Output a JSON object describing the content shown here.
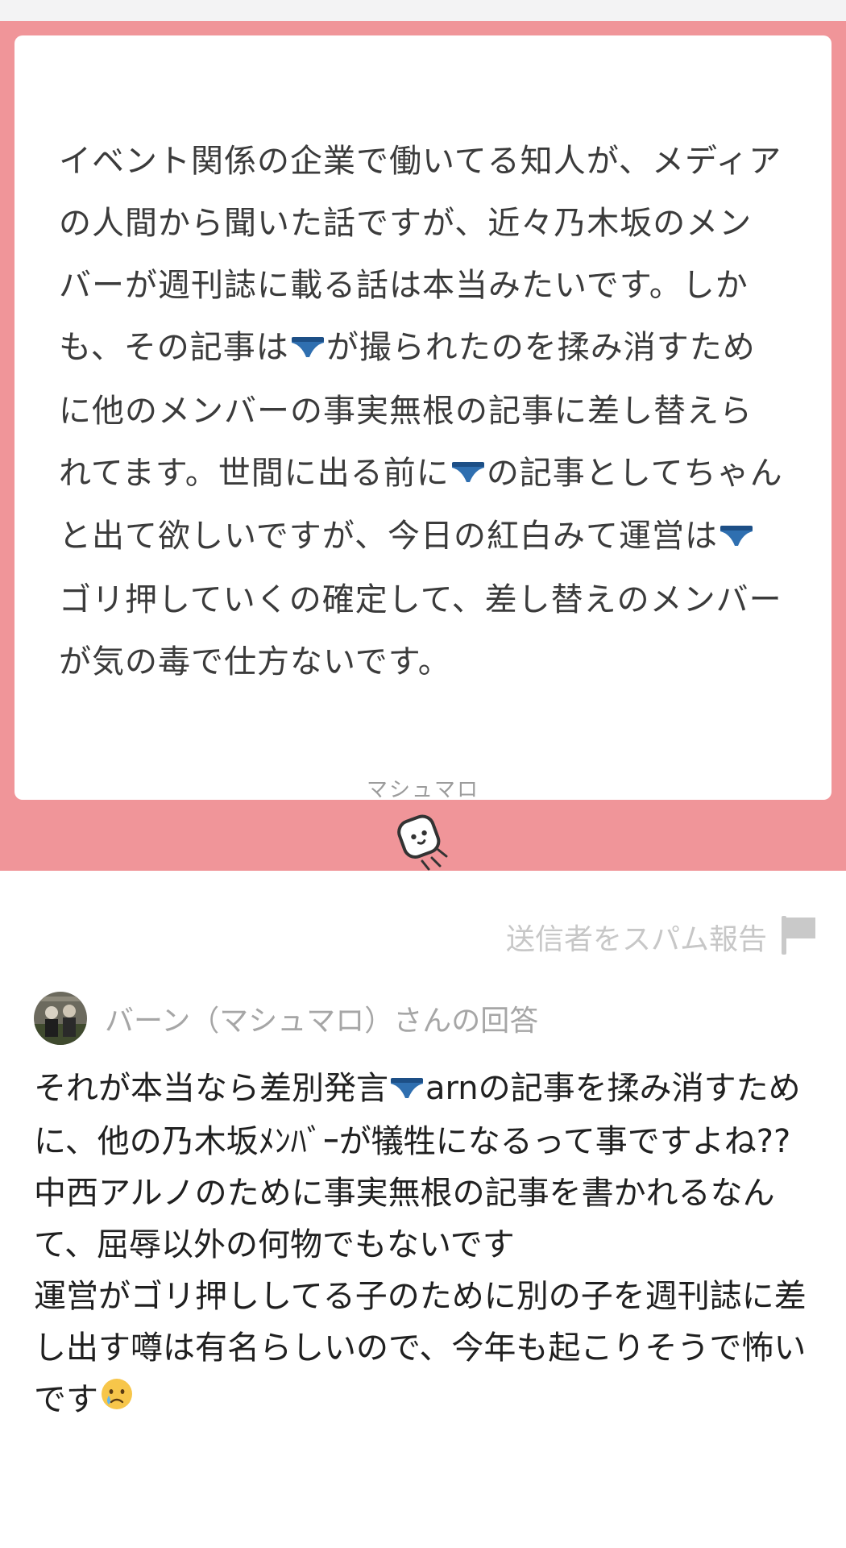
{
  "question": {
    "segments": [
      {
        "text": "イベント関係の企業で働いてる知人が、メディアの人間から聞いた話ですが、近々乃木坂のメンバーが週刊誌に載る話は本当みたいです。しかも、その記事は"
      },
      {
        "emoji": "blue-briefs-emoji"
      },
      {
        "text": "が撮られたのを揉み消すために他のメンバーの事実無根の記事に差し替えられてます。世間に出る前に"
      },
      {
        "emoji": "blue-briefs-emoji"
      },
      {
        "text": "の記事としてちゃんと出て欲しいですが、今日の紅白みて運営は"
      },
      {
        "emoji": "blue-briefs-emoji"
      },
      {
        "text": "ゴリ押していくの確定して、差し替えのメンバーが気の毒で仕方ないです。"
      }
    ]
  },
  "brand": {
    "label": "マシュマロ",
    "logo_icon": "marshmallow-logo-icon"
  },
  "report": {
    "label": "送信者をスパム報告",
    "icon": "flag-icon"
  },
  "answer": {
    "answerer_label": "バーン（マシュマロ）さんの回答",
    "segments": [
      {
        "text": "それが本当なら差別発言"
      },
      {
        "emoji": "blue-briefs-emoji"
      },
      {
        "text": "arnの記事を揉み消すために、他の乃木坂ﾒﾝﾊﾞｰが犠牲になるって事ですよね??\n中西アルノのために事実無根の記事を書かれるなんて、屈辱以外の何物でもないです\n運営がゴリ押ししてる子のために別の子を週刊誌に差し出す噂は有名らしいので、今年も起こりそうで怖いです"
      },
      {
        "emoji": "crying-face-emoji"
      }
    ]
  },
  "colors": {
    "panel_background": "#f09599",
    "card_background": "#ffffff",
    "question_text": "#3b3b3b",
    "answer_text": "#202020",
    "muted_text": "#a6a6a6",
    "briefs_blue": "#2f6fb0"
  }
}
